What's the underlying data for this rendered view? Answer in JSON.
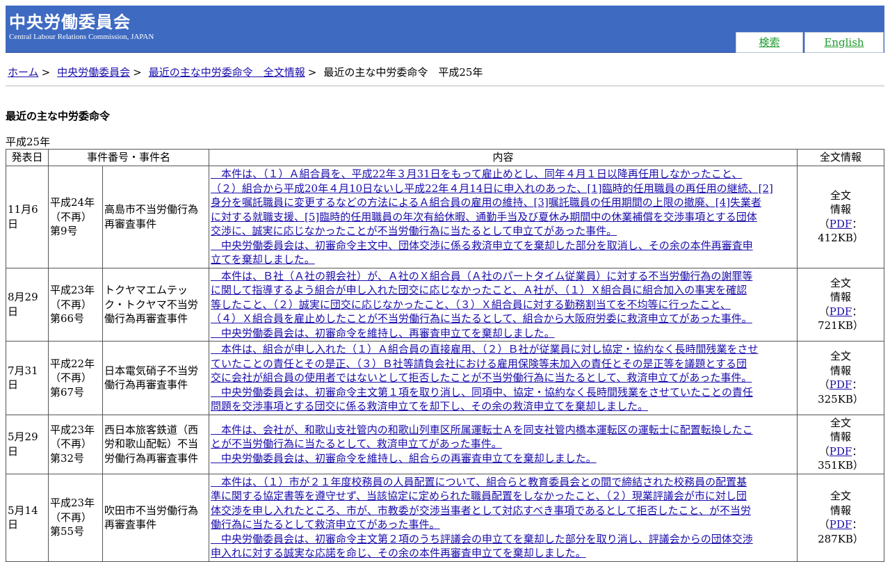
{
  "header": {
    "title": "中央労働委員会",
    "subtitle": "Central Labour Relations Commission, JAPAN",
    "search_label": "検索",
    "english_label": "English"
  },
  "breadcrumb": {
    "items": [
      "ホーム",
      "中央労働委員会",
      "最近の主な中労委命令　全文情報"
    ],
    "current": "最近の主な中労委命令　平成25年",
    "separator": ">"
  },
  "page_heading": "最近の主な中労委命令",
  "era_label": "平成25年",
  "table": {
    "headers": [
      "発表日",
      "事件番号・事件名",
      "内容",
      "全文情報"
    ],
    "rows": [
      {
        "date": "11月6日",
        "num_lines": [
          "平成24年",
          "（不再）",
          "第9号"
        ],
        "name": "高島市不当労働行為再審査事件",
        "content_lines": [
          "　本件は、（１）Ａ組合員を、平成22年３月31日をもって雇止めとし、同年４月１日以降再任用しなかったこと、",
          "（２）組合から平成20年４月10日ないし平成22年４月14日に申入れのあった、[1]臨時的任用職員の再任用の継続、[2]",
          "身分を嘱託職員に変更するなどの方法によるＡ組合員の雇用の維持、[3]嘱託職員の任用期間の上限の撤廃、[4]失業者",
          "に対する就職支援、[5]臨時的任用職員の年次有給休暇、通勤手当及び夏休み期間中の休業補償を交渉事項とする団体",
          "交渉に、誠実に応じなかったことが不当労働行為に当たるとして申立てがあった事件。",
          "　中央労働委員会は、初審命令主文中、団体交渉に係る救済申立てを棄却した部分を取消し、その余の本件再審査申",
          "立てを棄却しました。"
        ],
        "fulltext": [
          "全文",
          "情報"
        ],
        "pdf_label": "PDF",
        "size": "：412KB）"
      },
      {
        "date": "8月29日",
        "num_lines": [
          "平成23年",
          "（不再）",
          "第66号"
        ],
        "name": "トクヤマエムテック・トクヤマ不当労働行為再審査事件",
        "content_lines": [
          "　本件は、Ｂ社（Ａ社の親会社）が、Ａ社のＸ組合員（Ａ社のパートタイム従業員）に対する不当労働行為の謝罪等",
          "に関して指導するよう組合が申し入れた団交に応じなかったこと、Ａ社が、（１）Ｘ組合員に組合加入の事実を確認",
          "等したこと、（２）誠実に団交に応じなかったこと、（３）Ｘ組合員に対する勤務割当てを不均等に行ったこと、",
          "（４）Ｘ組合員を雇止めしたことが不当労働行為に当たるとして、組合から大阪府労委に救済申立てがあった事件。",
          "　中央労働委員会は、初審命令を維持し、再審査申立てを棄却しました。"
        ],
        "fulltext": [
          "全文",
          "情報"
        ],
        "pdf_label": "PDF",
        "size": "：721KB）"
      },
      {
        "date": "7月31日",
        "num_lines": [
          "平成22年",
          "（不再）",
          "第67号"
        ],
        "name": "日本電気硝子不当労働行為再審査事件",
        "content_lines": [
          "　本件は、組合が申し入れた（１）Ａ組合員の直接雇用、（２）Ｂ社が従業員に対し協定・協約なく長時間残業をさせ",
          "ていたことの責任とその是正、（３）Ｂ社等請負会社における雇用保険等未加入の責任とその是正等を議題とする団",
          "交に会社が組合員の使用者ではないとして拒否したことが不当労働行為に当たるとして、救済申立てがあった事件。",
          "　中央労働委員会は、初審命令主文第１項を取り消し、同項中、協定・協約なく長時間残業をさせていたことの責任",
          "問題を交渉事項とする団交に係る救済申立てを却下し、その余の救済申立てを棄却しました。"
        ],
        "fulltext": [
          "全文",
          "情報"
        ],
        "pdf_label": "PDF",
        "size": "：325KB）"
      },
      {
        "date": "5月29日",
        "num_lines": [
          "平成23年",
          "（不再）",
          "第32号"
        ],
        "name": "西日本旅客鉄道（西労和歌山配転）不当労働行為再審査事件",
        "content_lines": [
          "　本件は、会社が、和歌山支社管内の和歌山列車区所属運転士Ａを同支社管内橋本運転区の運転士に配置転換したこ",
          "とが不当労働行為に当たるとして、救済申立てがあった事件。",
          "　中央労働委員会は、初審命令を維持し、組合らの再審査申立てを棄却しました。"
        ],
        "fulltext": [
          "全文",
          "情報"
        ],
        "pdf_label": "PDF",
        "size": "：351KB）"
      },
      {
        "date": "5月14日",
        "num_lines": [
          "平成23年",
          "（不再）",
          "第55号"
        ],
        "name": "吹田市不当労働行為再審査事件",
        "content_lines": [
          "　本件は、（１）市が２１年度校務員の人員配置について、組合らと教育委員会との間で締結された校務員の配置基",
          "準に関する協定書等を遵守せず、当該協定に定められた職員配置をしなかったこと、（２）現業評議会が市に対し団",
          "体交渉を申し入れたところ、市が、市教委が交渉当事者として対応すべき事項であるとして拒否したこと、が不当労",
          "働行為に当たるとして救済申立てがあった事件。",
          "　中央労働委員会は、初審命令主文第２項のうち評議会の申立てを棄却した部分を取り消し、評議会からの団体交渉",
          "申入れに対する誠実な応諾を命じ、その余の本件再審査申立てを棄却しました。"
        ],
        "fulltext": [
          "全文",
          "情報"
        ],
        "pdf_label": "PDF",
        "size": "：287KB）"
      }
    ]
  }
}
